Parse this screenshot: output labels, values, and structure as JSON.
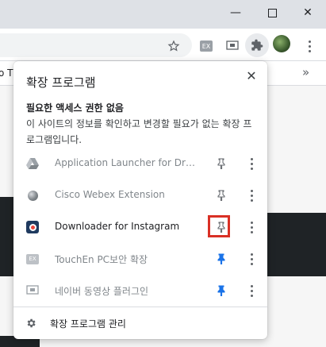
{
  "window": {
    "minimize_glyph": "—",
    "maximize_glyph": "☐",
    "close_glyph": "✕"
  },
  "toolbar": {
    "icons": [
      "star-icon",
      "touchen-ex-icon",
      "naver-video-icon",
      "extensions-puzzle-icon",
      "profile-avatar",
      "menu-kebab-icon"
    ]
  },
  "bookmarks": {
    "partial_label": "o T",
    "overflow_glyph": "»"
  },
  "popup": {
    "title": "확장 프로그램",
    "close_glyph": "✕",
    "section_heading": "필요한 액세스 권한 없음",
    "section_description": "이 사이트의 정보를 확인하고 변경할 필요가 없는 확장 프로그램입니다.",
    "extensions": [
      {
        "name": "Application Launcher for Drive...",
        "icon": "drive-icon",
        "pinned": false,
        "enabled": false
      },
      {
        "name": "Cisco Webex Extension",
        "icon": "webex-icon",
        "pinned": false,
        "enabled": false
      },
      {
        "name": "Downloader for Instagram",
        "icon": "instagram-downloader-icon",
        "pinned": false,
        "enabled": true,
        "highlighted": true
      },
      {
        "name": "TouchEn PC보안 확장",
        "icon": "touchen-ex-icon",
        "pinned": true,
        "enabled": false
      },
      {
        "name": "네이버 동영상 플러그인",
        "icon": "naver-video-icon",
        "pinned": true,
        "enabled": false
      }
    ],
    "manage_label": "확장 프로그램 관리"
  },
  "colors": {
    "pinned": "#1a73e8",
    "unpinned": "#5f6368",
    "highlight": "#d93025"
  }
}
